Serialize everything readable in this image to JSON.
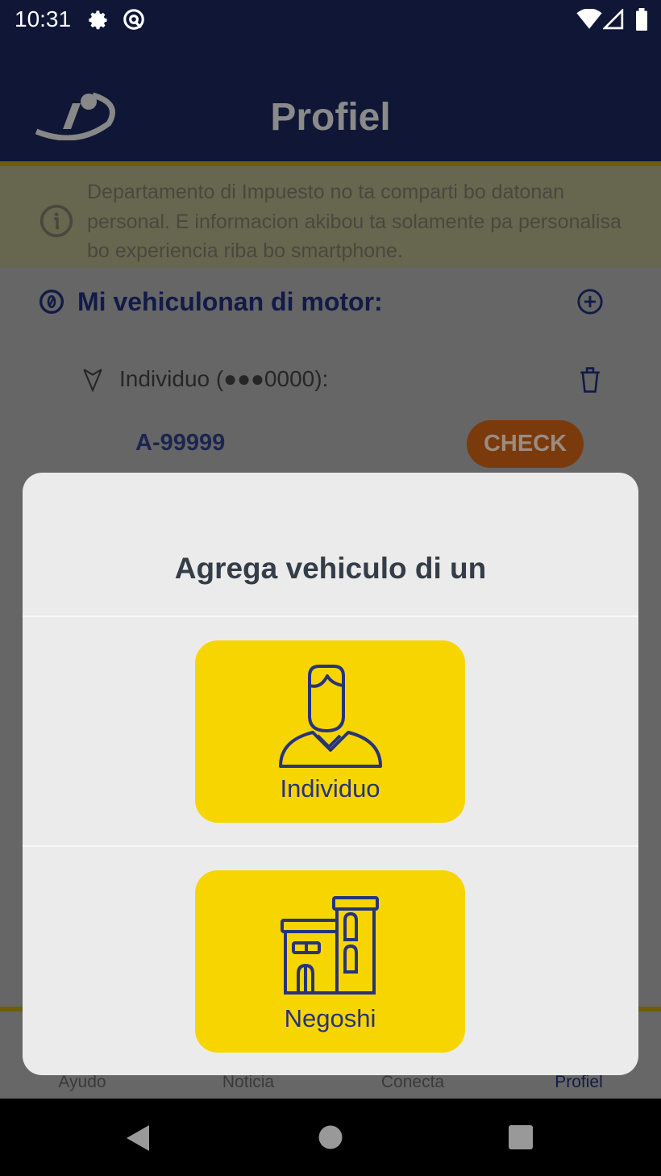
{
  "status_bar": {
    "time": "10:31",
    "icons": [
      "gear-icon",
      "at-sign-icon",
      "wifi-icon",
      "signal-icon",
      "battery-icon"
    ]
  },
  "header": {
    "title": "Profiel",
    "logo": "tax-department-logo"
  },
  "info_banner": {
    "text": "Departamento di Impuesto no ta comparti bo datonan personal. E informacion akibou ta solamente pa personalisa bo experiencia riba bo smartphone.",
    "icon": "info-icon"
  },
  "vehicles": {
    "title": "Mi vehiculonan di motor:",
    "group_label": "Individuo (●●●0000):",
    "plate": "A-99999",
    "check_label": "CHECK"
  },
  "bottom_nav": {
    "items": [
      {
        "label": "Ayudo"
      },
      {
        "label": "Noticia"
      },
      {
        "label": "Conecta"
      },
      {
        "label": "Profiel",
        "active": true
      }
    ]
  },
  "dialog": {
    "title": "Agrega vehiculo di un",
    "options": [
      {
        "label": "Individuo",
        "icon": "person-icon"
      },
      {
        "label": "Negoshi",
        "icon": "building-icon"
      }
    ]
  },
  "colors": {
    "navy": "#101636",
    "accent_yellow": "#f7d500",
    "icon_blue": "#27337a",
    "check_orange": "#7a3a0c"
  }
}
